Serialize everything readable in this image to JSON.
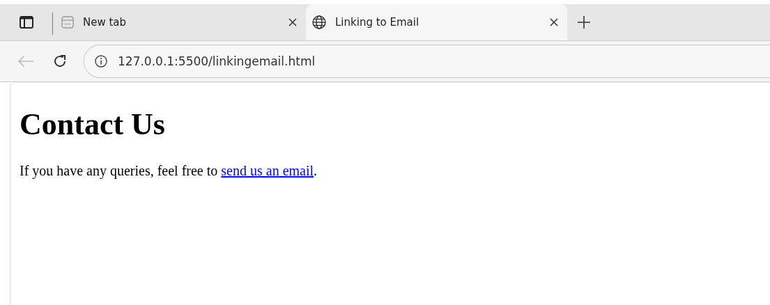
{
  "tabs": [
    {
      "title": "New tab",
      "selected": false,
      "kind": "blank"
    },
    {
      "title": "Linking to Email",
      "selected": true,
      "kind": "web"
    }
  ],
  "address_bar": {
    "url": "127.0.0.1:5500/linkingemail.html"
  },
  "page": {
    "heading": "Contact Us",
    "paragraph_before": "If you have any queries, feel free to",
    "link": "send us an email",
    "paragraph_after": "."
  }
}
